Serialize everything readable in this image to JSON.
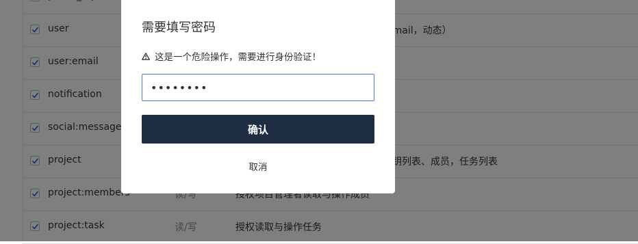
{
  "table": {
    "top_row_partial": "public_repo",
    "rows": [
      {
        "scope": "user",
        "perm": "",
        "desc": "email，动态）"
      },
      {
        "scope": "user:email",
        "perm": "",
        "desc": ""
      },
      {
        "scope": "notification",
        "perm": "",
        "desc": ""
      },
      {
        "scope": "social:message",
        "perm": "",
        "desc": ""
      },
      {
        "scope": "project",
        "perm": "",
        "desc": "钥列表、成员，任务列表"
      },
      {
        "scope": "project:members",
        "perm": "读/写",
        "desc": "授权项目管理者读取与操作成员"
      },
      {
        "scope": "project:task",
        "perm": "读/写",
        "desc": "授权读取与操作任务"
      }
    ]
  },
  "modal": {
    "title": "需要填写密码",
    "warning": "这是一个危险操作，需要进行身份验证！",
    "password_value": "••••••••",
    "confirm_label": "确认",
    "cancel_label": "取消"
  },
  "colors": {
    "primary_button": "#1f2d42",
    "input_focus_border": "#3b82d6",
    "overlay": "rgba(0,0,0,0.5)"
  }
}
